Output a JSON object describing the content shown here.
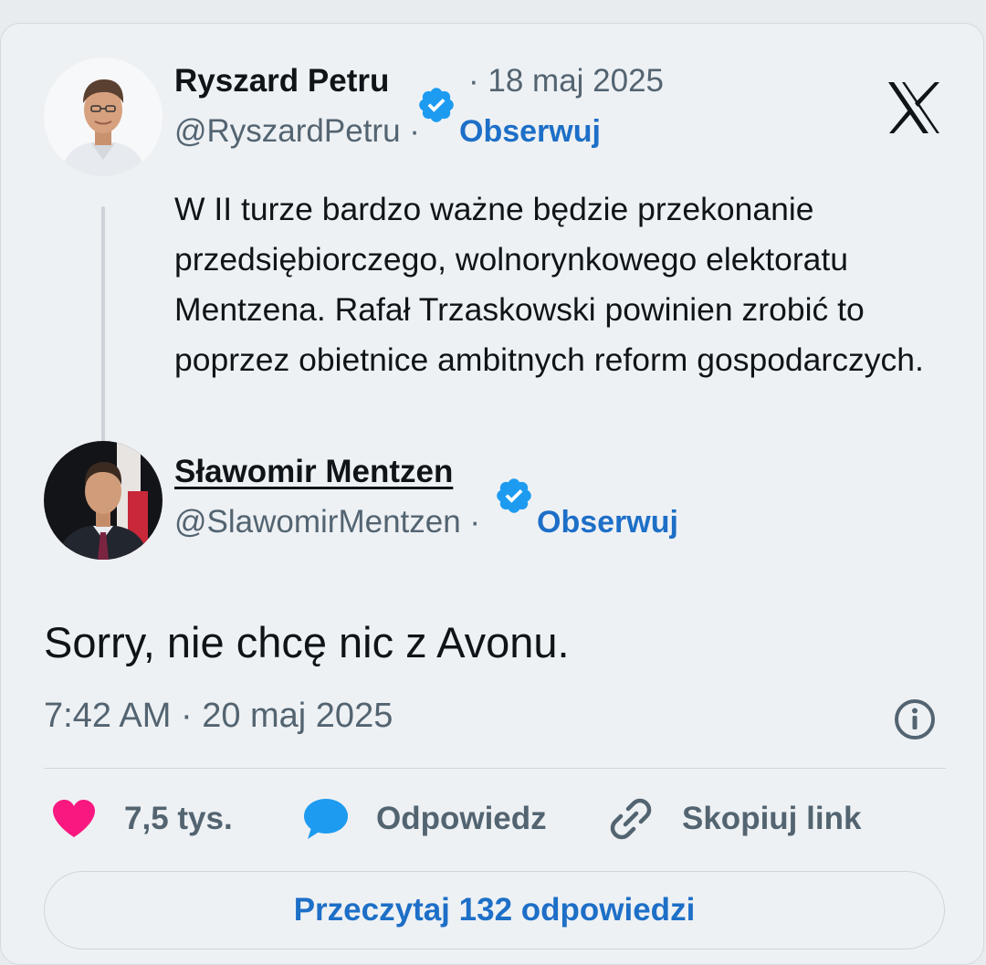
{
  "quoted_tweet": {
    "author_name": "Ryszard Petru",
    "date": "· 18 maj 2025",
    "handle": "@RyszardPetru ·",
    "follow_label": "Obserwuj",
    "text": "W II turze bardzo ważne będzie przekonanie przedsiębiorczego, wolnorynkowego elektoratu Mentzena. Rafał Trzaskowski powinien zrobić to poprzez obietnice ambitnych reform gospodarczych."
  },
  "tweet": {
    "author_name": "Sławomir Mentzen",
    "handle": "@SlawomirMentzen ·",
    "follow_label": "Obserwuj",
    "text": "Sorry, nie chcę nic z Avonu.",
    "timestamp": "7:42 AM · 20 maj 2025"
  },
  "actions": {
    "like_count": "7,5 tys.",
    "reply_label": "Odpowiedz",
    "copy_link_label": "Skopiuj link",
    "read_replies_label": "Przeczytaj 132 odpowiedzi"
  },
  "icons": {
    "logo": "x-logo-icon",
    "verified": "verified-badge-icon",
    "info": "info-icon",
    "like": "heart-icon",
    "reply": "speech-bubble-icon",
    "copy": "link-icon"
  },
  "colors": {
    "accent_blue": "#1d6fc7",
    "verified_blue": "#1d9bf0",
    "like_pink": "#f91880",
    "text": "#0f1419",
    "muted": "#536471",
    "card_bg": "#eef1f4"
  }
}
